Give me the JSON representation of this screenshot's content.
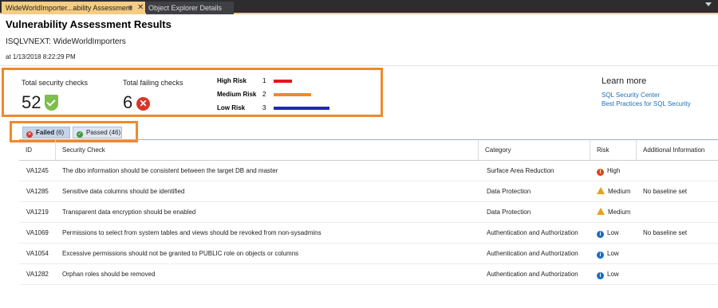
{
  "tabs": {
    "active": "WideWorldImporter...ability Assessment",
    "pin": "⊕",
    "close": "✕",
    "inactive": "Object Explorer Details"
  },
  "header": {
    "title": "Vulnerability Assessment Results",
    "server": "ISQLVNEXT: WideWorldImporters",
    "scan_time": "at 1/13/2018 8:22:29 PM"
  },
  "summary": {
    "total_checks_label": "Total security checks",
    "total_checks_value": "52",
    "failing_label": "Total failing checks",
    "failing_value": "6",
    "risks": [
      {
        "name": "High Risk",
        "count": "1",
        "color": "#e3161d"
      },
      {
        "name": "Medium Risk",
        "count": "2",
        "color": "#f08a24"
      },
      {
        "name": "Low Risk",
        "count": "3",
        "color": "#1d28b8"
      }
    ]
  },
  "learn_more": {
    "title": "Learn more",
    "links": [
      "SQL Security Center",
      "Best Practices for SQL Security"
    ]
  },
  "filters": {
    "failed_label": "Failed",
    "failed_count": "(6)",
    "passed_label": "Passed",
    "passed_count": "(46)"
  },
  "table": {
    "columns": [
      "ID",
      "Security Check",
      "Category",
      "Risk",
      "Additional Information"
    ],
    "rows": [
      {
        "id": "VA1245",
        "check": "The dbo information should be consistent between the target DB and master",
        "category": "Surface Area Reduction",
        "risk": "High",
        "info": ""
      },
      {
        "id": "VA1285",
        "check": "Sensitive data columns should be identified",
        "category": "Data Protection",
        "risk": "Medium",
        "info": "No baseline set"
      },
      {
        "id": "VA1219",
        "check": "Transparent data encryption should be enabled",
        "category": "Data Protection",
        "risk": "Medium",
        "info": ""
      },
      {
        "id": "VA1069",
        "check": "Permissions to select from system tables and views should be revoked from non-sysadmins",
        "category": "Authentication and Authorization",
        "risk": "Low",
        "info": "No baseline set"
      },
      {
        "id": "VA1054",
        "check": "Excessive permissions should not be granted to PUBLIC role on objects or columns",
        "category": "Authentication and Authorization",
        "risk": "Low",
        "info": ""
      },
      {
        "id": "VA1282",
        "check": "Orphan roles should be removed",
        "category": "Authentication and Authorization",
        "risk": "Low",
        "info": ""
      }
    ]
  }
}
